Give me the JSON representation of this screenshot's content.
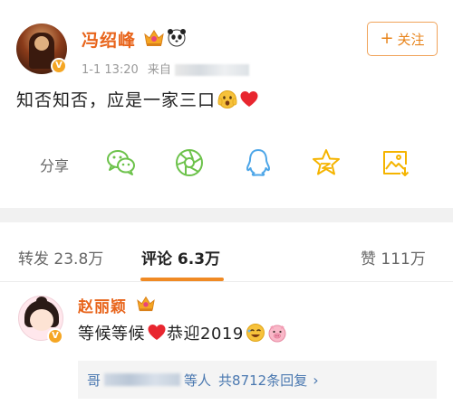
{
  "post": {
    "username": "冯绍峰",
    "verified_badge": "V",
    "time": "1-1 13:20",
    "source_prefix": "来自",
    "follow_plus": "+",
    "follow_label": "关注",
    "content": "知否知否，应是一家三口",
    "share_label": "分享",
    "share_icons": [
      "wechat-icon",
      "moments-icon",
      "qq-icon",
      "qzone-star-icon",
      "save-image-icon"
    ]
  },
  "tabs": {
    "repost_label": "转发",
    "repost_count": "23.8万",
    "comment_label": "评论",
    "comment_count": "6.3万",
    "like_label": "赞",
    "like_count": "111万"
  },
  "comment": {
    "username": "赵丽颖",
    "verified_badge": "V",
    "text_a": "等候等候",
    "text_b": "恭迎2019",
    "replies_prefix": "哥",
    "replies_suffix": "等人",
    "replies_count": "共8712条回复",
    "replies_chevron": "›"
  },
  "colors": {
    "accent_orange": "#e8641b",
    "follow_border": "#f0a35a",
    "link_blue": "#4a78b0",
    "icon_green": "#6cc24a",
    "icon_blue": "#4da6e8",
    "icon_yellow": "#f5b400"
  }
}
